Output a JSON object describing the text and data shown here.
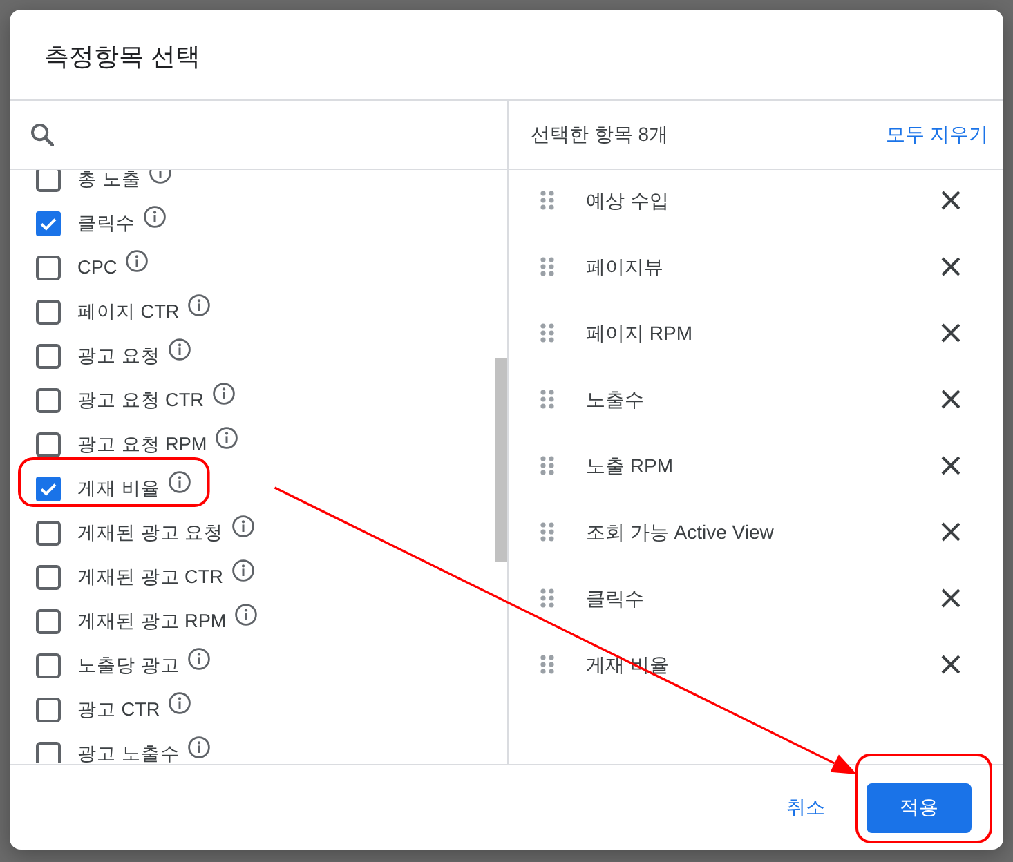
{
  "dialog": {
    "title": "측정항목 선택"
  },
  "metrics": [
    {
      "label": "총 노출",
      "checked": false,
      "highlighted": false
    },
    {
      "label": "클릭수",
      "checked": true,
      "highlighted": false
    },
    {
      "label": "CPC",
      "checked": false,
      "highlighted": false
    },
    {
      "label": "페이지 CTR",
      "checked": false,
      "highlighted": false
    },
    {
      "label": "광고 요청",
      "checked": false,
      "highlighted": false
    },
    {
      "label": "광고 요청 CTR",
      "checked": false,
      "highlighted": false
    },
    {
      "label": "광고 요청 RPM",
      "checked": false,
      "highlighted": false
    },
    {
      "label": "게재 비율",
      "checked": true,
      "highlighted": true
    },
    {
      "label": "게재된 광고 요청",
      "checked": false,
      "highlighted": false
    },
    {
      "label": "게재된 광고 CTR",
      "checked": false,
      "highlighted": false
    },
    {
      "label": "게재된 광고 RPM",
      "checked": false,
      "highlighted": false
    },
    {
      "label": "노출당 광고",
      "checked": false,
      "highlighted": false
    },
    {
      "label": "광고 CTR",
      "checked": false,
      "highlighted": false
    },
    {
      "label": "광고 노출수",
      "checked": false,
      "highlighted": false
    }
  ],
  "selected_panel": {
    "heading": "선택한 항목 8개",
    "clear_all": "모두 지우기",
    "items": [
      "예상 수입",
      "페이지뷰",
      "페이지 RPM",
      "노출수",
      "노출 RPM",
      "조회 가능 Active View",
      "클릭수",
      "게재 비율"
    ]
  },
  "footer": {
    "buttons": [
      {
        "label": "취소",
        "kind": "text",
        "highlighted": false
      },
      {
        "label": "적용",
        "kind": "primary",
        "highlighted": true
      }
    ]
  },
  "pointer_arrow": true
}
